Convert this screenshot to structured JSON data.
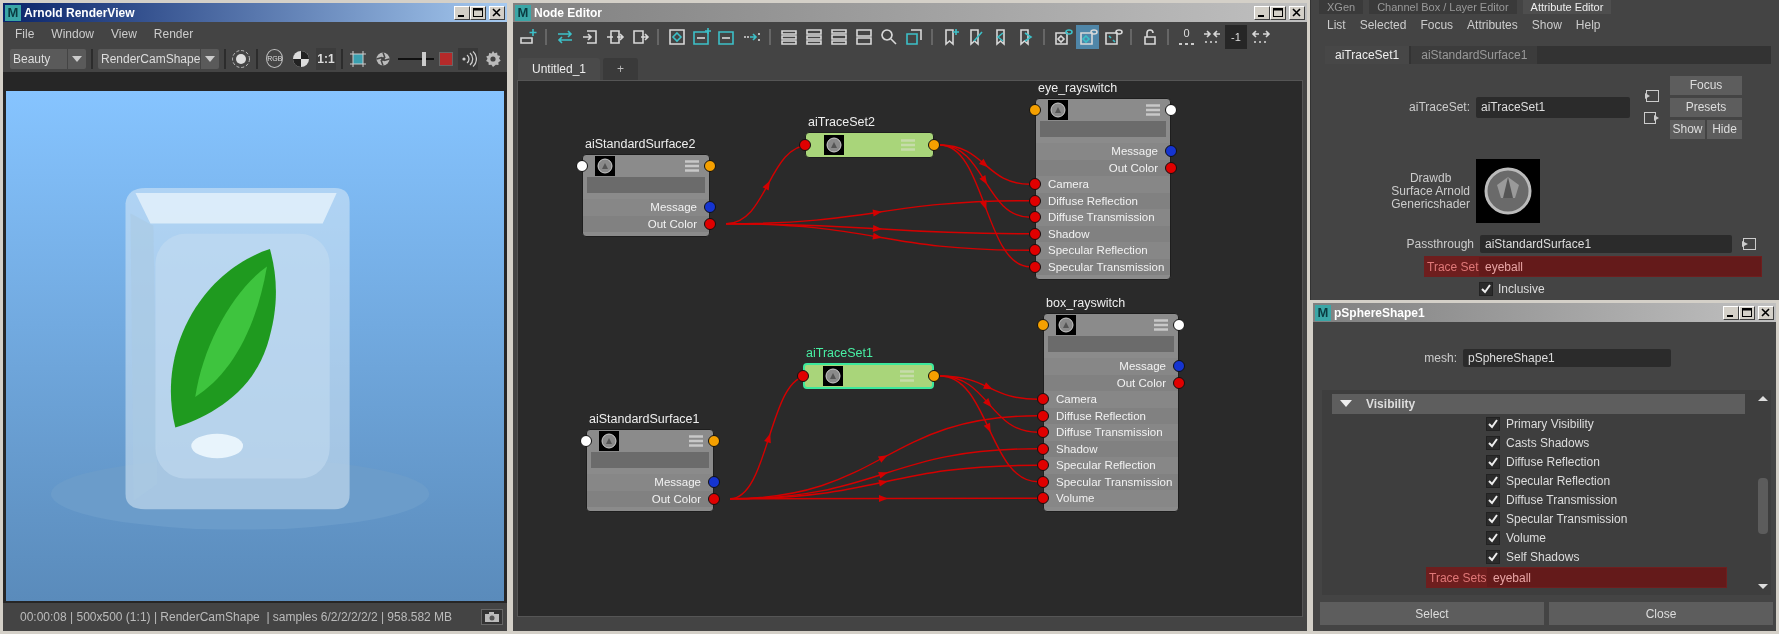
{
  "render_view": {
    "window": {
      "logo": "M",
      "title": "Arnold RenderView",
      "active": true
    },
    "menu": [
      "File",
      "Window",
      "View",
      "Render"
    ],
    "toolbar": {
      "aov": "Beauty",
      "camera": "RenderCamShape",
      "rgb_label": "RGB",
      "zoom_label": "1:1",
      "exposure": {
        "level": 0.72
      }
    },
    "status": "00:00:08 | 500x500 (1:1) | RenderCamShape  | samples 6/2/2/2/2/2 | 958.582 MB"
  },
  "node_editor": {
    "window": {
      "logo": "M",
      "title": "Node Editor",
      "active": false
    },
    "tool_groups": [
      {
        "tools": [
          {
            "kind": "create",
            "pressed": false
          }
        ]
      },
      {
        "tools": [
          {
            "kind": "swap",
            "pressed": false
          },
          {
            "kind": "input",
            "pressed": false
          },
          {
            "kind": "inout",
            "pressed": false
          },
          {
            "kind": "output",
            "pressed": false
          }
        ]
      },
      {
        "tools": [
          {
            "kind": "frame-all",
            "pressed": false
          },
          {
            "kind": "frame-add",
            "pressed": false
          },
          {
            "kind": "frame-remove",
            "pressed": false
          },
          {
            "kind": "flow",
            "pressed": false
          }
        ]
      },
      {
        "tools": [
          {
            "kind": "layout-a",
            "pressed": false
          },
          {
            "kind": "layout-b",
            "pressed": false
          },
          {
            "kind": "layout-c",
            "pressed": false
          },
          {
            "kind": "layout-d",
            "pressed": false
          },
          {
            "kind": "search",
            "pressed": false
          },
          {
            "kind": "zoom-box",
            "pressed": false
          }
        ]
      },
      {
        "tools": [
          {
            "kind": "bookmark-add",
            "pressed": false
          },
          {
            "kind": "bookmark-edit",
            "pressed": false
          },
          {
            "kind": "bookmark-prev",
            "pressed": false
          },
          {
            "kind": "bookmark-next",
            "pressed": false
          }
        ]
      },
      {
        "tools": [
          {
            "kind": "graph-a",
            "pressed": false
          },
          {
            "kind": "graph-b",
            "pressed": true
          },
          {
            "kind": "graph-c",
            "pressed": false
          }
        ]
      },
      {
        "tools": [
          {
            "kind": "lock",
            "pressed": false
          }
        ]
      },
      {
        "tools": [
          {
            "kind": "counter",
            "label": "0",
            "pressed": false
          },
          {
            "kind": "collapse",
            "pressed": false
          },
          {
            "kind": "field",
            "value": "-1"
          },
          {
            "kind": "expand",
            "pressed": false
          }
        ]
      }
    ],
    "tabs": [
      {
        "label": "Untitled_1",
        "selected": true
      },
      {
        "label": "+",
        "selected": false
      }
    ],
    "nodes": [
      {
        "name": "aiStandardSurface2",
        "kind": "surface",
        "selected": false,
        "ports": [
          {
            "label": "Message",
            "kind": "message"
          },
          {
            "label": "Out Color",
            "kind": "output"
          }
        ]
      },
      {
        "name": "aiTraceSet2",
        "kind": "traceset",
        "selected": false
      },
      {
        "name": "eye_rayswitch",
        "kind": "rayswitch",
        "selected": false,
        "ports": [
          {
            "label": "Message",
            "kind": "message"
          },
          {
            "label": "Out Color",
            "kind": "output"
          },
          {
            "label": "Camera",
            "kind": "input"
          },
          {
            "label": "Diffuse Reflection",
            "kind": "input"
          },
          {
            "label": "Diffuse Transmission",
            "kind": "input"
          },
          {
            "label": "Shadow",
            "kind": "input"
          },
          {
            "label": "Specular Reflection",
            "kind": "input"
          },
          {
            "label": "Specular Transmission",
            "kind": "input"
          }
        ]
      },
      {
        "name": "aiStandardSurface1",
        "kind": "surface",
        "selected": false,
        "ports": [
          {
            "label": "Message",
            "kind": "message"
          },
          {
            "label": "Out Color",
            "kind": "output"
          }
        ]
      },
      {
        "name": "aiTraceSet1",
        "kind": "traceset",
        "selected": true
      },
      {
        "name": "box_rayswitch",
        "kind": "rayswitch",
        "selected": false,
        "ports": [
          {
            "label": "Message",
            "kind": "message"
          },
          {
            "label": "Out Color",
            "kind": "output"
          },
          {
            "label": "Camera",
            "kind": "input"
          },
          {
            "label": "Diffuse Reflection",
            "kind": "input"
          },
          {
            "label": "Diffuse Transmission",
            "kind": "input"
          },
          {
            "label": "Shadow",
            "kind": "input"
          },
          {
            "label": "Specular Reflection",
            "kind": "input"
          },
          {
            "label": "Specular Transmission",
            "kind": "input"
          },
          {
            "label": "Volume",
            "kind": "input"
          }
        ]
      }
    ]
  },
  "attribute_editor": {
    "panel_tabs": [
      {
        "label": "XGen",
        "selected": false
      },
      {
        "label": "Channel Box / Layer Editor",
        "selected": false
      },
      {
        "label": "Attribute Editor",
        "selected": true
      }
    ],
    "menu": [
      "List",
      "Selected",
      "Focus",
      "Attributes",
      "Show",
      "Help"
    ],
    "node_tabs": [
      {
        "label": "aiTraceSet1",
        "selected": true
      },
      {
        "label": "aiStandardSurface1",
        "selected": false
      }
    ],
    "node_field": {
      "label": "aiTraceSet:",
      "value": "aiTraceSet1"
    },
    "buttons": [
      "Focus",
      "Presets",
      "Show",
      "Hide"
    ],
    "swatch_label": "Drawdb Surface Arnold Genericshader",
    "passthrough": {
      "label": "Passthrough",
      "value": "aiStandardSurface1"
    },
    "trace_set": {
      "label": "Trace Set",
      "value": "eyeball",
      "connected": true
    },
    "inclusive": {
      "label": "Inclusive",
      "checked": true
    }
  },
  "shape_window": {
    "window": {
      "logo": "M",
      "title": "pSphereShape1",
      "active": false
    },
    "mesh": {
      "label": "mesh:",
      "value": "pSphereShape1"
    },
    "section": {
      "label": "Visibility",
      "expanded": true
    },
    "flags": [
      {
        "label": "Primary Visibility",
        "checked": true
      },
      {
        "label": "Casts Shadows",
        "checked": true
      },
      {
        "label": "Diffuse Reflection",
        "checked": true
      },
      {
        "label": "Specular Reflection",
        "checked": true
      },
      {
        "label": "Diffuse Transmission",
        "checked": true
      },
      {
        "label": "Specular Transmission",
        "checked": true
      },
      {
        "label": "Volume",
        "checked": true
      },
      {
        "label": "Self Shadows",
        "checked": true
      }
    ],
    "trace_sets": {
      "label": "Trace Sets",
      "value": "eyeball",
      "connected": true
    },
    "buttons": [
      "Select",
      "Close"
    ]
  }
}
